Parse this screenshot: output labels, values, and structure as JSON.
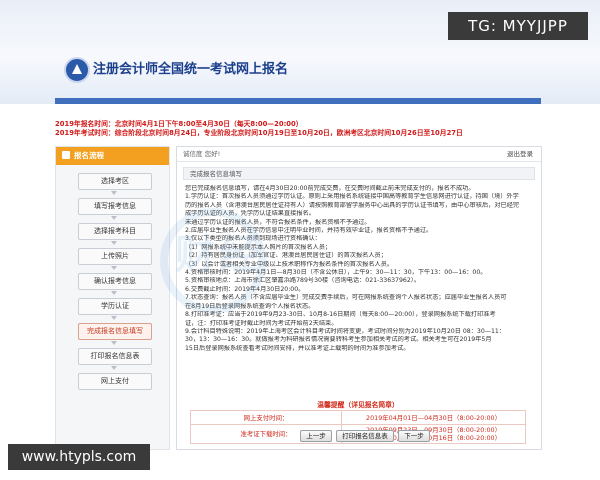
{
  "header": {
    "site_title": "注册会计师全国统一考试网上报名",
    "logo": "cicpa-logo-icon",
    "overlay_tag": "TG: MYYJJPP"
  },
  "notice": {
    "line1": "2019年报名时间：北京时间4月1日下午8:00至4月30日（每天8:00—20:00）",
    "line2": "2019年考试时间：综合阶段北京时间8月24日，专业阶段北京时间10月19日至10月20日，欧洲考区北京时间10月26日至10月27日"
  },
  "sidebar": {
    "header": "报名流程",
    "steps": [
      "选择考区",
      "填写报考信息",
      "选择报考科目",
      "上传照片",
      "确认报考信息",
      "学历认证",
      "完成报名信息填写",
      "打印报名信息表",
      "网上支付"
    ],
    "active_index": 6
  },
  "main": {
    "user_info": "诚信度 您好!",
    "logout": "退出登录",
    "section_tab": "完成报名信息填写",
    "paragraphs": [
      "您已完成报名信息填写，请在4月30日20:00前完成交费，在交费时间截止前未完成支付的，报名不成功。",
      "1.学历认证：首次报名人员须通过学历认证。原则上采用报名系统链接中国高等教育学生信息网进行认证，持国（境）外学",
      "历的报名人员（含港澳台居民居住证持有人）请按照教育部留学服务中心出具的学历认证书填写，由中心审核后，对已经完",
      "成学历认证的人员，凭学历认证结果直接报名。",
      "未通过学历认证的报名人员，不符合报名条件，报名资格不予通过。",
      "2.应届毕业生报名人员在学历信息中注明毕业时间，并持有效毕业证，报名资格不予通过。",
      "3.仅以下类型的报名人员须到现场进行资格确认：",
      "（1）网报系统中未能提示本人照片的首次报名人员；",
      "（2）持有居民身份证（加军官证、港澳台居民居住证）的首次报名人员；",
      "（3）以会计或者相关专业中级以上技术职称作为报名条件的首次报名人员。",
      "4.资格审核时间：2019年4月1日—8月30日（不含公休日），上午9：30—11：30，下午13：00—16：00。",
      "5.资格审核地点：上海市徐汇区肇嘉浜路789号30楼（咨询电话：021-33637962）。",
      "6.交费截止时间：2019年4月30日20:00。",
      "7.状态查询：报名人员（不含应届毕业生）完成交费手续后，可在网报系统查询个人报名状态；应届毕业生报名人员可",
      "在8月19日后登录网报系统查询个人报名状态。",
      "8.打印准考证：应当于2019年9月23-30日、10月8-16日期间（每天8:00—20:00），登录网报系统下载打印准考",
      "证，注：打印准考证时截止时间为考试开始前2天结束。",
      "9.会计科目特殊说明：2019年上海考区会计科目考试时间将变更，考试时间分别为2019年10月20日 08：30—11：",
      "30，13：30—16：30。就做报考为科研报名情况需要转科考生参加相关考试的考试。相关考生可在2019年5月",
      "15日后登录网报系统查看考试时间安排，并以准考证上载明的时间为准参加考试。"
    ],
    "reminder": {
      "title": "温馨提醒（详见报名简章）",
      "rows": [
        {
          "label": "网上支付时间：",
          "value": "2019年04月01日—04月30日（8:00-20:00）"
        },
        {
          "label": "准考证下载时间：",
          "value": "2019年09月23日—09月30日（8:00-20:00）\n2019年10月08日—10月16日（8:00-20:00）"
        }
      ]
    },
    "buttons": {
      "prev": "上一步",
      "print": "打印报名信息表",
      "next": "下一步"
    }
  },
  "watermark": {
    "text": "财经"
  },
  "footer_overlay": {
    "url": "www.htypls.com"
  }
}
